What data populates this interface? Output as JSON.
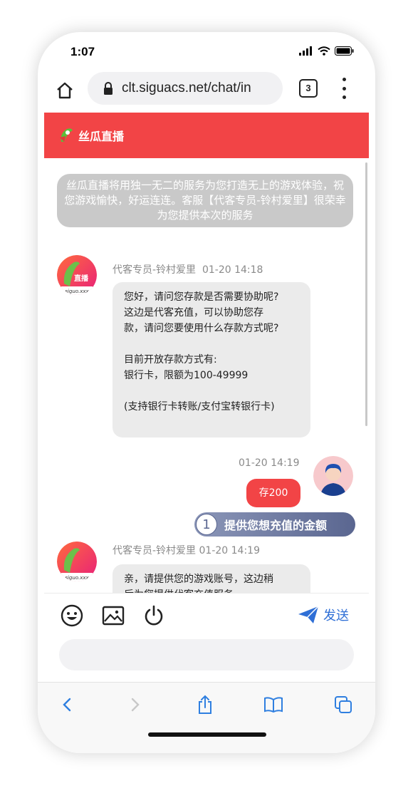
{
  "status_bar": {
    "time": "1:07"
  },
  "browser": {
    "url": "clt.siguacs.net/chat/in",
    "tab_count": "3"
  },
  "app": {
    "title": "丝瓜直播",
    "logo_text": "直播",
    "logo_domain": "siguo.xxx"
  },
  "chat": {
    "notice": "丝瓜直播将用独一无二的服务为您打造无上的游戏体验，祝您游戏愉快，好运连连。客服【代客专员-铃村爱里】很荣幸为您提供本次的服务",
    "messages": [
      {
        "sender": "代客专员-铃村爱里",
        "time": "01-20 14:18",
        "lines": [
          "您好，请问您存款是否需要协助呢?",
          "这边是代客充值，可以协助您存",
          "款，请问您要使用什么存款方式呢?",
          "",
          "目前开放存款方式有:",
          "银行卡，限额为100-49999",
          "",
          "(支持银行卡转账/支付宝转银行卡)"
        ]
      },
      {
        "time": "01-20 14:19",
        "text": "存200"
      },
      {
        "sender": "代客专员-铃村爱里",
        "time": "01-20 14:19",
        "lines": [
          "亲，请提供您的游戏账号，这边稍",
          "后为您提供代客充值服务。"
        ]
      }
    ],
    "tip": {
      "number": "1",
      "text": "提供您想充值的金额"
    }
  },
  "toolbar": {
    "send_label": "发送"
  },
  "icons": {
    "status": [
      "signal-icon",
      "wifi-icon",
      "battery-icon"
    ],
    "browser": [
      "home-icon",
      "lock-icon",
      "more-icon"
    ],
    "toolbar": [
      "emoji-icon",
      "image-icon",
      "power-icon",
      "send-icon"
    ],
    "nav": [
      "back-icon",
      "forward-icon",
      "share-icon",
      "bookmarks-icon",
      "tabs-icon"
    ]
  },
  "colors": {
    "brand_red": "#f24446",
    "send_blue": "#2f6fd6",
    "nav_blue": "#2f7fe0"
  }
}
